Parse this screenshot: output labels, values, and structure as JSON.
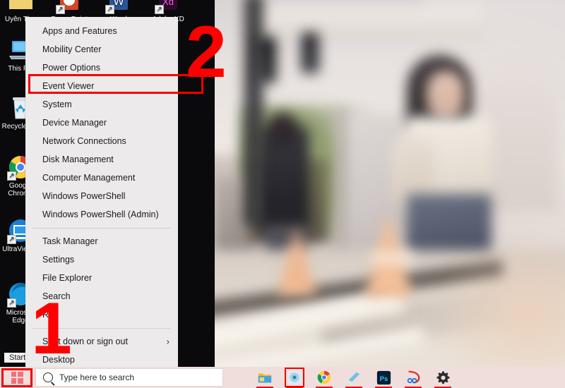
{
  "desktop": {
    "icons": [
      {
        "name": "uyen-thu-folder",
        "label": "Uyên Thư",
        "kind": "folder"
      },
      {
        "name": "powerpoint",
        "label": "PowerPoint",
        "kind": "powerpoint"
      },
      {
        "name": "word",
        "label": "Word",
        "kind": "word"
      },
      {
        "name": "adobe-xd",
        "label": "Adobe XD",
        "kind": "xd"
      },
      {
        "name": "this-pc",
        "label": "This PC",
        "kind": "pc"
      },
      {
        "name": "recycle-bin",
        "label": "Recycle Bin",
        "kind": "recycle"
      },
      {
        "name": "google-chrome",
        "label": "Google Chrome",
        "kind": "chrome"
      },
      {
        "name": "ultraviewer",
        "label": "UltraViewer",
        "kind": "ultraviewer"
      },
      {
        "name": "microsoft-edge",
        "label": "Microsoft Edge",
        "kind": "edge"
      }
    ],
    "start_label": "Start"
  },
  "winx_menu": {
    "items": [
      {
        "label": "Apps and Features",
        "submenu": false,
        "separator_after": false
      },
      {
        "label": "Mobility Center",
        "submenu": false,
        "separator_after": false
      },
      {
        "label": "Power Options",
        "submenu": false,
        "separator_after": false,
        "highlighted": true
      },
      {
        "label": "Event Viewer",
        "submenu": false,
        "separator_after": false
      },
      {
        "label": "System",
        "submenu": false,
        "separator_after": false
      },
      {
        "label": "Device Manager",
        "submenu": false,
        "separator_after": false
      },
      {
        "label": "Network Connections",
        "submenu": false,
        "separator_after": false
      },
      {
        "label": "Disk Management",
        "submenu": false,
        "separator_after": false
      },
      {
        "label": "Computer Management",
        "submenu": false,
        "separator_after": false
      },
      {
        "label": "Windows PowerShell",
        "submenu": false,
        "separator_after": false
      },
      {
        "label": "Windows PowerShell (Admin)",
        "submenu": false,
        "separator_after": true
      },
      {
        "label": "Task Manager",
        "submenu": false,
        "separator_after": false
      },
      {
        "label": "Settings",
        "submenu": false,
        "separator_after": false
      },
      {
        "label": "File Explorer",
        "submenu": false,
        "separator_after": false
      },
      {
        "label": "Search",
        "submenu": false,
        "separator_after": false
      },
      {
        "label": "Run",
        "submenu": false,
        "separator_after": true
      },
      {
        "label": "Shut down or sign out",
        "submenu": true,
        "separator_after": false
      },
      {
        "label": "Desktop",
        "submenu": false,
        "separator_after": false
      }
    ],
    "submenu_arrow": "›"
  },
  "annotations": [
    {
      "name": "step-1-marker",
      "text": "1"
    },
    {
      "name": "step-2-marker",
      "text": "2"
    }
  ],
  "taskbar": {
    "start_button_name": "start-button",
    "search": {
      "placeholder": "Type here to search",
      "value": "Type here to search"
    },
    "icons": [
      {
        "name": "file-explorer-icon",
        "label": "File Explorer",
        "boxed": false
      },
      {
        "name": "media-player-icon",
        "label": "Media App",
        "boxed": true
      },
      {
        "name": "google-chrome-icon",
        "label": "Google Chrome",
        "boxed": false
      },
      {
        "name": "sticky-notes-icon",
        "label": "Sticky Notes",
        "boxed": false
      },
      {
        "name": "photoshop-icon",
        "label": "Photoshop",
        "boxed": false
      },
      {
        "name": "snagit-icon",
        "label": "Snagit",
        "boxed": false
      },
      {
        "name": "settings-gear-icon",
        "label": "Settings",
        "boxed": false
      }
    ]
  },
  "colors": {
    "annotation_red": "#ff0000",
    "highlight_red": "#f20000",
    "menu_bg": "#eceaea",
    "taskbar_bg": "#f0dedc"
  }
}
